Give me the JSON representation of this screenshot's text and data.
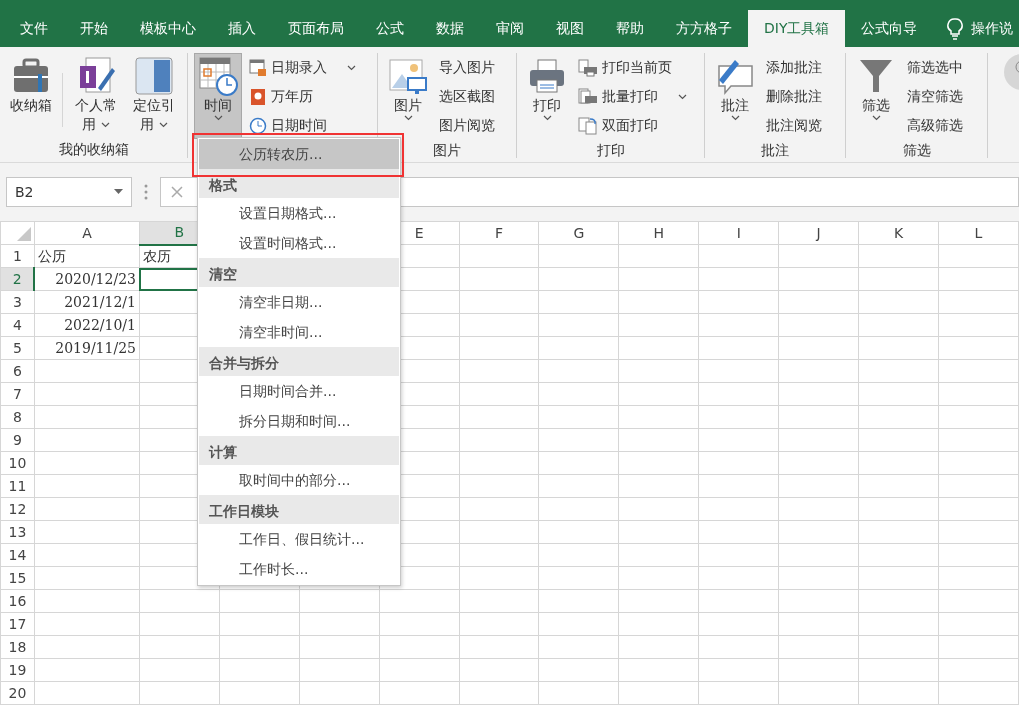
{
  "tabs": [
    {
      "label": "文件",
      "selected": false
    },
    {
      "label": "开始",
      "selected": false
    },
    {
      "label": "模板中心",
      "selected": false
    },
    {
      "label": "插入",
      "selected": false
    },
    {
      "label": "页面布局",
      "selected": false
    },
    {
      "label": "公式",
      "selected": false
    },
    {
      "label": "数据",
      "selected": false
    },
    {
      "label": "审阅",
      "selected": false
    },
    {
      "label": "视图",
      "selected": false
    },
    {
      "label": "帮助",
      "selected": false
    },
    {
      "label": "方方格子",
      "selected": false
    },
    {
      "label": "DIY工具箱",
      "selected": true
    },
    {
      "label": "公式向导",
      "selected": false
    }
  ],
  "tell_me": {
    "label": "操作说"
  },
  "ribbon": {
    "groups": [
      {
        "label": "我的收纳箱",
        "large": [
          {
            "label": "收纳箱",
            "dropdown": false,
            "pressed": false
          },
          {
            "label": "个人常用",
            "dropdown": true,
            "pressed": false
          },
          {
            "label": "定位引用",
            "dropdown": true,
            "pressed": false
          }
        ]
      },
      {
        "large": [
          {
            "label": "时间",
            "dropdown": true,
            "pressed": true
          }
        ],
        "small": [
          {
            "label": "日期录入",
            "dropdown": true
          },
          {
            "label": "万年历",
            "dropdown": false
          },
          {
            "label": "日期时间",
            "dropdown": false
          }
        ]
      },
      {
        "label": "图片",
        "large": [
          {
            "label": "图片",
            "dropdown": true,
            "pressed": false
          }
        ],
        "small": [
          {
            "label": "导入图片",
            "dropdown": false
          },
          {
            "label": "选区截图",
            "dropdown": false
          },
          {
            "label": "图片阅览",
            "dropdown": false
          }
        ]
      },
      {
        "label": "打印",
        "large": [
          {
            "label": "打印",
            "dropdown": true,
            "pressed": false
          }
        ],
        "small": [
          {
            "label": "打印当前页",
            "dropdown": false
          },
          {
            "label": "批量打印",
            "dropdown": true
          },
          {
            "label": "双面打印",
            "dropdown": false
          }
        ]
      },
      {
        "label": "批注",
        "large": [
          {
            "label": "批注",
            "dropdown": true,
            "pressed": false
          }
        ],
        "small": [
          {
            "label": "添加批注",
            "dropdown": false
          },
          {
            "label": "删除批注",
            "dropdown": false
          },
          {
            "label": "批注阅览",
            "dropdown": false
          }
        ]
      },
      {
        "label": "筛选",
        "large": [
          {
            "label": "筛选",
            "dropdown": true,
            "pressed": false
          }
        ],
        "small": [
          {
            "label": "筛选选中",
            "dropdown": false
          },
          {
            "label": "清空筛选",
            "dropdown": false
          },
          {
            "label": "高级筛选",
            "dropdown": false
          }
        ]
      }
    ]
  },
  "name_box": {
    "value": "B2"
  },
  "sheet": {
    "columns": [
      {
        "label": "A",
        "selected": false
      },
      {
        "label": "B",
        "selected": true
      },
      {},
      {},
      {
        "label": "E",
        "selected": false
      },
      {
        "label": "F",
        "selected": false
      },
      {
        "label": "G",
        "selected": false
      },
      {
        "label": "H",
        "selected": false
      },
      {
        "label": "I",
        "selected": false
      },
      {
        "label": "J",
        "selected": false
      },
      {
        "label": "K",
        "selected": false
      },
      {
        "label": "L",
        "selected": false
      }
    ],
    "rows": [
      {
        "label": "1",
        "selected": false,
        "cells": [
          {
            "text": "公历",
            "kind": "text",
            "selected": false
          },
          {
            "text": "农历",
            "kind": "text",
            "selected": false
          }
        ]
      },
      {
        "label": "2",
        "selected": true,
        "cells": [
          {
            "text": "2020/12/23",
            "kind": "date",
            "selected": false
          },
          {
            "kind": "blank",
            "selected": true
          }
        ]
      },
      {
        "label": "3",
        "selected": false,
        "cells": [
          {
            "text": "2021/12/1",
            "kind": "date",
            "selected": false
          }
        ]
      },
      {
        "label": "4",
        "selected": false,
        "cells": [
          {
            "text": "2022/10/1",
            "kind": "date",
            "selected": false
          }
        ]
      },
      {
        "label": "5",
        "selected": false,
        "cells": [
          {
            "text": "2019/11/25",
            "kind": "date",
            "selected": false
          }
        ]
      },
      {
        "label": "6",
        "selected": false,
        "cells": []
      },
      {
        "label": "7",
        "selected": false,
        "cells": []
      },
      {
        "label": "8",
        "selected": false,
        "cells": []
      },
      {
        "label": "9",
        "selected": false,
        "cells": []
      },
      {
        "label": "10",
        "selected": false,
        "cells": []
      },
      {
        "label": "11",
        "selected": false,
        "cells": []
      },
      {
        "label": "12",
        "selected": false,
        "cells": []
      },
      {
        "label": "13",
        "selected": false,
        "cells": []
      },
      {
        "label": "14",
        "selected": false,
        "cells": []
      },
      {
        "label": "15",
        "selected": false,
        "cells": []
      },
      {
        "label": "16",
        "selected": false,
        "cells": []
      },
      {
        "label": "17",
        "selected": false,
        "cells": []
      },
      {
        "label": "18",
        "selected": false,
        "cells": []
      },
      {
        "label": "19",
        "selected": false,
        "cells": []
      },
      {
        "label": "20",
        "selected": false,
        "cells": []
      }
    ]
  },
  "menu": {
    "items": [
      {
        "kind": "item",
        "label": "公历转农历...",
        "selected": true
      },
      {
        "kind": "header",
        "label": "格式"
      },
      {
        "kind": "item",
        "label": "设置日期格式...",
        "selected": false
      },
      {
        "kind": "item",
        "label": "设置时间格式...",
        "selected": false
      },
      {
        "kind": "header",
        "label": "清空"
      },
      {
        "kind": "item",
        "label": "清空非日期...",
        "selected": false
      },
      {
        "kind": "item",
        "label": "清空非时间...",
        "selected": false
      },
      {
        "kind": "header",
        "label": "合并与拆分"
      },
      {
        "kind": "item",
        "label": "日期时间合并...",
        "selected": false
      },
      {
        "kind": "item",
        "label": "拆分日期和时间...",
        "selected": false
      },
      {
        "kind": "header",
        "label": "计算"
      },
      {
        "kind": "item",
        "label": "取时间中的部分...",
        "selected": false
      },
      {
        "kind": "header",
        "label": "工作日模块"
      },
      {
        "kind": "item",
        "label": "工作日、假日统计...",
        "selected": false
      },
      {
        "kind": "item",
        "label": "工作时长...",
        "selected": false
      }
    ]
  }
}
